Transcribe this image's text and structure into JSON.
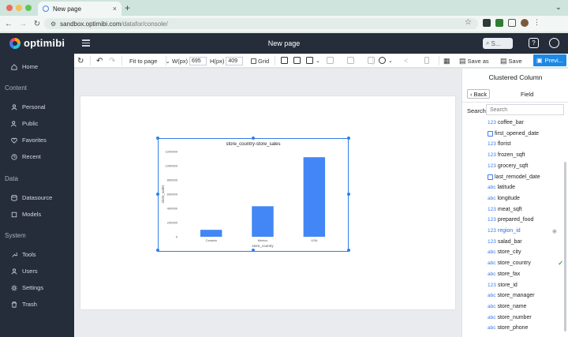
{
  "browser": {
    "tab_title": "New page",
    "url_host": "sandbox.optimibi.com",
    "url_path": "/datafor/console/"
  },
  "app": {
    "brand": "optimibi",
    "page_title": "New page",
    "search_placeholder": "S..."
  },
  "sidebar": {
    "items_top": [
      {
        "label": "Home",
        "icon": "home-icon"
      }
    ],
    "sections": [
      {
        "title": "Content",
        "items": [
          {
            "label": "Personal",
            "icon": "user-icon"
          },
          {
            "label": "Public",
            "icon": "group-icon"
          },
          {
            "label": "Favorites",
            "icon": "heart-icon"
          },
          {
            "label": "Recent",
            "icon": "clock-icon"
          }
        ]
      },
      {
        "title": "Data",
        "items": [
          {
            "label": "Datasource",
            "icon": "database-icon"
          },
          {
            "label": "Models",
            "icon": "cube-icon"
          }
        ]
      },
      {
        "title": "System",
        "items": [
          {
            "label": "Tools",
            "icon": "wrench-icon"
          },
          {
            "label": "Users",
            "icon": "users-icon"
          },
          {
            "label": "Settings",
            "icon": "gear-icon"
          },
          {
            "label": "Trash",
            "icon": "trash-icon"
          }
        ]
      }
    ]
  },
  "toolbar": {
    "fit_label": "Fit to page",
    "width_label": "W(px)",
    "width_value": "695",
    "height_label": "H(px)",
    "height_value": "409",
    "grid_label": "Grid",
    "save_as_label": "Save as",
    "save_label": "Save",
    "preview_label": "Previ..."
  },
  "chart_data": {
    "type": "bar",
    "title": "store_country-store_sales",
    "xlabel": "store_country",
    "ylabel": "store_sales",
    "categories": [
      "Canada",
      "Mexico",
      "USA"
    ],
    "values": [
      98000,
      430000,
      1120000
    ],
    "ylim": [
      0,
      1200000
    ],
    "yticks": [
      "0",
      "200000",
      "400000",
      "600000",
      "800000",
      "1000000",
      "1200000"
    ],
    "bar_color": "#4287f5",
    "grid": false,
    "legend": "none"
  },
  "panel": {
    "title": "Clustered Column",
    "back_label": "Back",
    "field_tab": "Field",
    "search_label": "Search",
    "search_placeholder": "Search",
    "fields": [
      {
        "type": "123",
        "name": "coffee_bar"
      },
      {
        "type": "date",
        "name": "first_opened_date"
      },
      {
        "type": "123",
        "name": "florist"
      },
      {
        "type": "123",
        "name": "frozen_sqft"
      },
      {
        "type": "123",
        "name": "grocery_sqft"
      },
      {
        "type": "date",
        "name": "last_remodel_date"
      },
      {
        "type": "abc",
        "name": "latitude"
      },
      {
        "type": "abc",
        "name": "longitude"
      },
      {
        "type": "123",
        "name": "meat_sqft"
      },
      {
        "type": "123",
        "name": "prepared_food"
      },
      {
        "type": "123",
        "name": "region_id",
        "selected": true
      },
      {
        "type": "123",
        "name": "salad_bar"
      },
      {
        "type": "abc",
        "name": "store_city"
      },
      {
        "type": "abc",
        "name": "store_country",
        "checked": true
      },
      {
        "type": "abc",
        "name": "store_fax"
      },
      {
        "type": "123",
        "name": "store_id"
      },
      {
        "type": "abc",
        "name": "store_manager"
      },
      {
        "type": "abc",
        "name": "store_name"
      },
      {
        "type": "abc",
        "name": "store_number"
      },
      {
        "type": "abc",
        "name": "store_phone"
      }
    ]
  }
}
